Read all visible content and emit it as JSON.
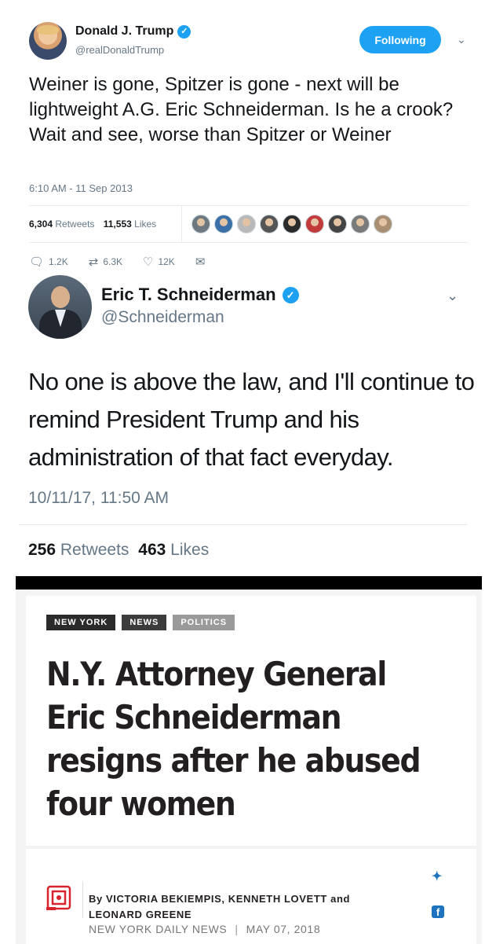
{
  "tweet1": {
    "name": "Donald J. Trump",
    "handle": "@realDonaldTrump",
    "follow_label": "Following",
    "text": "Weiner is gone, Spitzer is gone - next will be lightweight A.G. Eric Schneiderman. Is he a crook? Wait and see, worse than Spitzer or Weiner",
    "timestamp": "6:10 AM - 11 Sep 2013",
    "retweets_count": "6,304",
    "retweets_label": "Retweets",
    "likes_count": "11,553",
    "likes_label": "Likes",
    "liker_avatar_colors": [
      "#6d7880",
      "#3b6fa8",
      "#b9b9b9",
      "#555555",
      "#2b2b2b",
      "#c23a3a",
      "#444444",
      "#7a7a7a",
      "#a98f72"
    ],
    "replies": "1.2K",
    "retweets_short": "6.3K",
    "likes_short": "12K"
  },
  "tweet2": {
    "name": "Eric T. Schneiderman",
    "handle": "@Schneiderman",
    "text": "No one is above the law, and I'll continue to remind President Trump and his administration of that fact everyday.",
    "timestamp": "10/11/17, 11:50 AM",
    "retweets_count": "256",
    "retweets_label": "Retweets",
    "likes_count": "463",
    "likes_label": "Likes"
  },
  "article": {
    "tags": [
      {
        "label": "NEW YORK",
        "color": "#2b2b2b"
      },
      {
        "label": "NEWS",
        "color": "#3c3c3c"
      },
      {
        "label": "POLITICS",
        "color": "#9a9a9a"
      }
    ],
    "headline": "N.Y. Attorney General Eric Schneiderman resigns after he abused four women",
    "byline_authors": "By VICTORIA BEKIEMPIS, KENNETH LOVETT and LEONARD GREENE",
    "source": "NEW YORK DAILY NEWS",
    "date": "MAY 07, 2018"
  },
  "colors": {
    "twitter_blue": "#1da1f2",
    "daily_news_red": "#d9232d"
  },
  "icons": [
    "verified-badge-icon",
    "chevron-down-icon",
    "reply-icon",
    "retweet-icon",
    "like-icon",
    "dm-icon",
    "twitter-share-icon",
    "facebook-share-icon",
    "daily-news-logo"
  ]
}
